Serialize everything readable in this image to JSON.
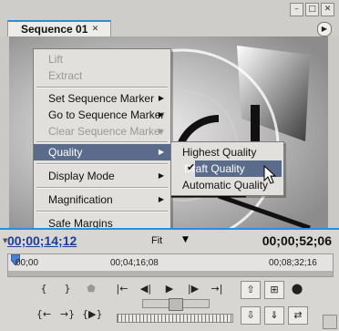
{
  "window": {
    "buttons": [
      {
        "name": "minimize",
        "glyph": "–"
      },
      {
        "name": "maximize",
        "glyph": "□"
      },
      {
        "name": "close",
        "glyph": "✕"
      }
    ]
  },
  "tab": {
    "label": "Sequence 01",
    "close_glyph": "✕",
    "menu_glyph": "▶"
  },
  "context_menu": {
    "items": [
      {
        "label": "Lift",
        "disabled": true
      },
      {
        "label": "Extract",
        "disabled": true
      },
      {
        "label": "Set Sequence Marker",
        "submenu": true
      },
      {
        "label": "Go to Sequence Marker",
        "submenu": true
      },
      {
        "label": "Clear Sequence Marker",
        "submenu": true,
        "disabled": true
      },
      {
        "label": "Quality",
        "submenu": true,
        "highlight": true
      },
      {
        "label": "Display Mode",
        "submenu": true
      },
      {
        "label": "Magnification",
        "submenu": true
      },
      {
        "label": "Safe Margins"
      }
    ]
  },
  "quality_submenu": {
    "items": [
      {
        "label": "Highest Quality"
      },
      {
        "label": "Draft Quality",
        "checked": true
      },
      {
        "label": "Automatic Quality"
      }
    ]
  },
  "timecode": {
    "current": "00;00;14;12",
    "zoom": "Fit",
    "zoom_arrow": "▼",
    "duration": "00;00;52;06"
  },
  "ruler": {
    "labels": [
      "00;00",
      "00;04;16;08",
      "00;08;32;16"
    ]
  },
  "colors": {
    "accent": "#2b8fd6",
    "timecode_blue": "#1a3fa0",
    "menu_highlight": "#5a6b8c"
  }
}
